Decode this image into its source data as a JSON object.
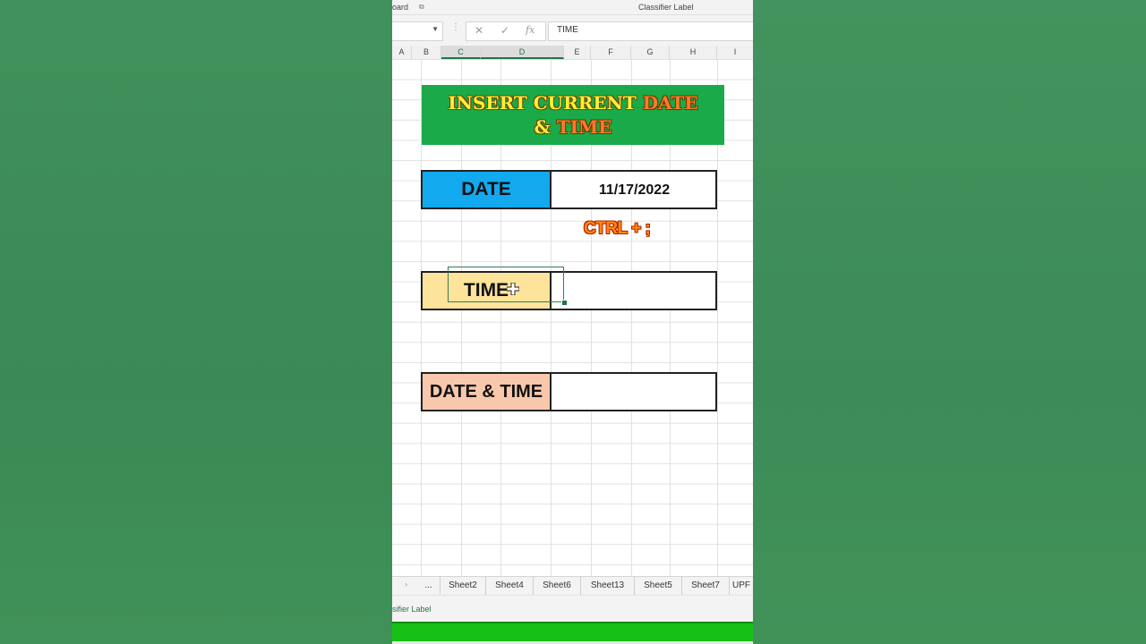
{
  "ribbon": {
    "clipboard_fragment": "oard",
    "classifier_label": "Classifier Label"
  },
  "formula_bar": {
    "cancel_glyph": "✕",
    "enter_glyph": "✓",
    "fx_glyph": "fx",
    "content": "TIME"
  },
  "columns": [
    "A",
    "B",
    "C",
    "D",
    "E",
    "F",
    "G",
    "H",
    "I"
  ],
  "banner": {
    "line1_part1": "INSERT CURRENT ",
    "line1_part2": "DATE",
    "line2_part1": "& ",
    "line2_part2": "TIME"
  },
  "rows": {
    "date": {
      "label": "DATE",
      "value": "11/17/2022"
    },
    "time": {
      "label": "TIME",
      "value": ""
    },
    "datetime": {
      "label": "DATE & TIME",
      "value": ""
    }
  },
  "shortcut_hint": "CTRL + ;",
  "sheet_tabs": {
    "ellipsis": "...",
    "items": [
      "Sheet2",
      "Sheet4",
      "Sheet6",
      "Sheet13",
      "Sheet5",
      "Sheet7",
      "UPF"
    ]
  },
  "status": {
    "classifier_fragment": "sifier Label"
  },
  "colors": {
    "banner_bg": "#1aaa4a",
    "date_label_bg": "#12a9ef",
    "time_label_bg": "#fde49a",
    "datetime_label_bg": "#f8c8ac",
    "excel_green": "#217346",
    "bottom_bar": "#16c016"
  }
}
